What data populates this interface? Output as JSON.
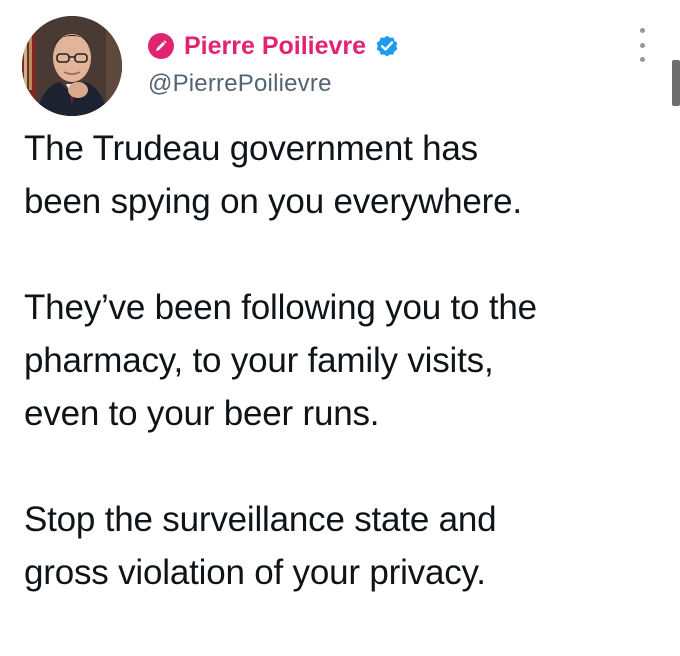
{
  "author": {
    "display_name": "Pierre Poilievre",
    "handle": "@PierrePoilievre",
    "verified": true,
    "name_color": "#e0246f",
    "badge_icon": "pencil-badge-icon",
    "verified_icon": "verified-badge-icon",
    "avatar_icon": "profile-photo"
  },
  "menu": {
    "icon": "more-options-icon"
  },
  "tweet": {
    "paragraphs": [
      "The Trudeau government has\nbeen spying on you everywhere.",
      "They’ve been following you to the\npharmacy, to your family visits,\neven to your beer runs.",
      "Stop the surveillance state and\ngross violation of your privacy."
    ]
  },
  "colors": {
    "accent": "#e0246f",
    "verified_blue": "#1d9bf0",
    "secondary_text": "#536471",
    "text": "#0f1419"
  }
}
